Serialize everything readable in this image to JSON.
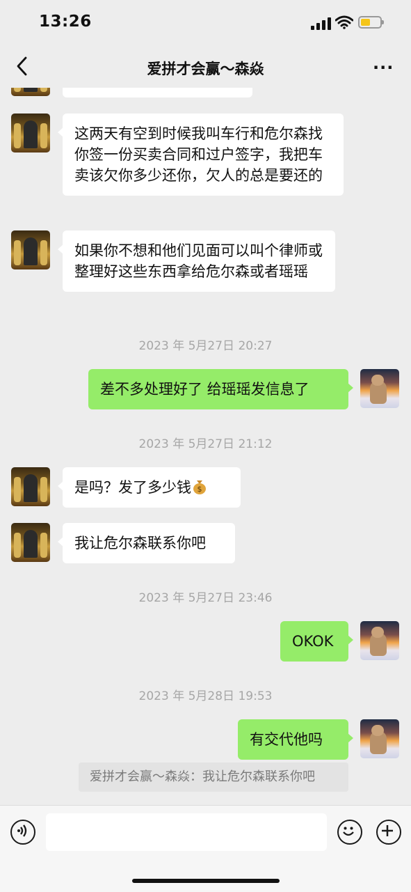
{
  "status_bar": {
    "time": "13:26"
  },
  "header": {
    "title": "爱拼才会赢～森焱",
    "back_icon": "chevron-left-icon",
    "more_icon": "more-dots-icon"
  },
  "messages": [
    {
      "side": "left",
      "text": "这两天有空到时候我叫车行和危尔森找你签一份买卖合同和过户签字，我把车卖该欠你多少还你，欠人的总是要还的"
    },
    {
      "side": "left",
      "text": "如果你不想和他们见面可以叫个律师或整理好这些东西拿给危尔森或者瑶瑶"
    },
    {
      "side": "time",
      "text": "2023 年 5月27日 20:27"
    },
    {
      "side": "right",
      "text": "差不多处理好了 给瑶瑶发信息了"
    },
    {
      "side": "time",
      "text": "2023 年 5月27日 21:12"
    },
    {
      "side": "left",
      "text": "是吗？发了多少钱",
      "emoji": "money-bag-icon"
    },
    {
      "side": "left",
      "text": "我让危尔森联系你吧"
    },
    {
      "side": "time",
      "text": "2023 年 5月27日 23:46"
    },
    {
      "side": "right",
      "text": "OKOK"
    },
    {
      "side": "time",
      "text": "2023 年 5月28日 19:53"
    },
    {
      "side": "right",
      "text": "有交代他吗"
    }
  ],
  "quote": {
    "text": "爱拼才会赢～森焱：我让危尔森联系你吧"
  },
  "input_bar": {
    "voice_icon": "voice-icon",
    "emoji_icon": "emoji-icon",
    "add_icon": "plus-icon",
    "value": ""
  },
  "colors": {
    "background": "#ededed",
    "sent_bubble": "#95ec69",
    "received_bubble": "#ffffff",
    "timestamp": "#a6a6a6"
  }
}
